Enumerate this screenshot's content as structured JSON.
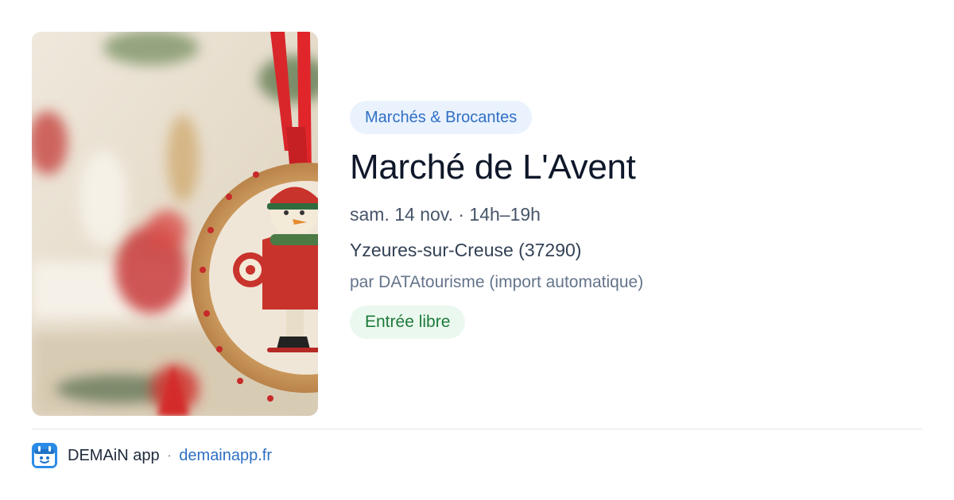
{
  "event": {
    "category": "Marchés & Brocantes",
    "title": "Marché de L'Avent",
    "date_time": "sam. 14 nov. · 14h–19h",
    "location": "Yzeures-sur-Creuse (37290)",
    "source": "par DATAtourisme (import automatique)",
    "price": "Entrée libre",
    "image_subject": "christmas-ornament-photo"
  },
  "footer": {
    "app_icon": "demain-app-icon",
    "app_name": "DEMAiN app",
    "separator": "·",
    "link": "demainapp.fr"
  },
  "colors": {
    "category_bg": "#eaf2fd",
    "category_text": "#2f6fc4",
    "price_bg": "#ebf8ef",
    "price_text": "#1e7a3a",
    "brand": "#2a8be6",
    "link": "#2f6fc4"
  }
}
